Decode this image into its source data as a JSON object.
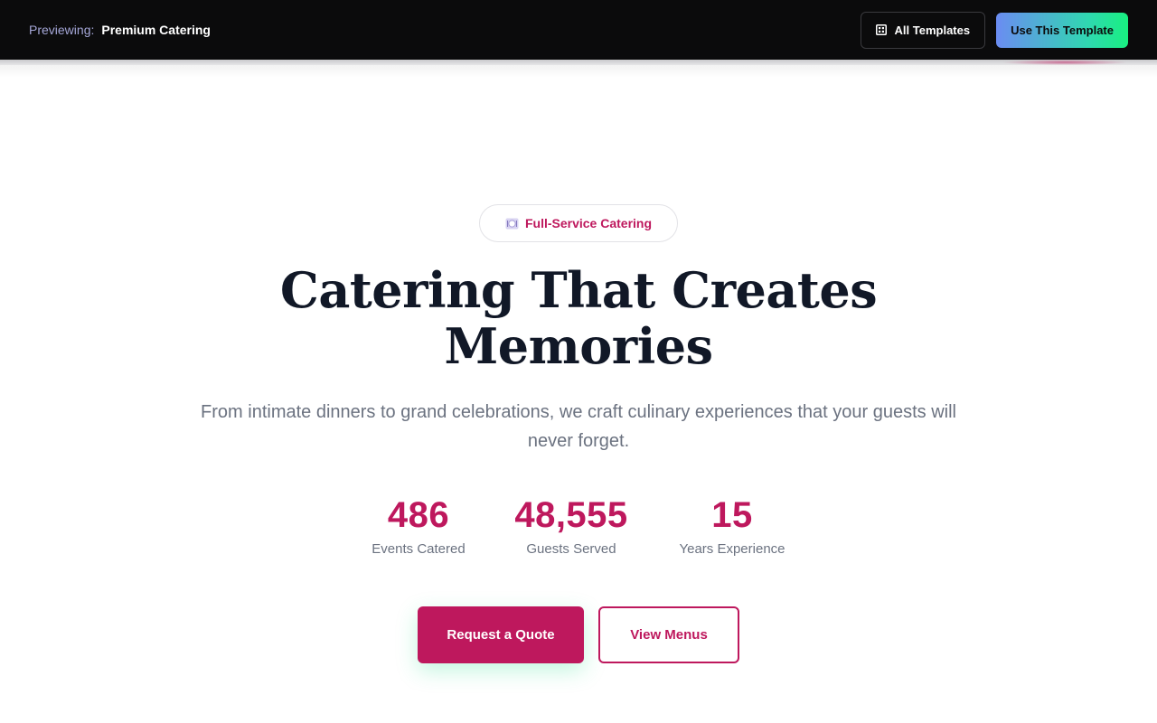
{
  "topbar": {
    "previewing_label": "Previewing:",
    "template_name": "Premium Catering",
    "all_templates_label": "All Templates",
    "all_templates_icon": "grid-icon",
    "use_template_label": "Use This Template"
  },
  "hero": {
    "badge_icon": "plate-icon",
    "badge_label": "Full-Service Catering",
    "headline_line1": "Catering That Creates",
    "headline_line2": "Memories",
    "subheadline": "From intimate dinners to grand celebrations, we craft culinary experiences that your guests will never forget.",
    "stats": [
      {
        "value": "486",
        "label": "Events Catered"
      },
      {
        "value": "48,555",
        "label": "Guests Served"
      },
      {
        "value": "15",
        "label": "Years Experience"
      }
    ],
    "primary_button": "Request a Quote",
    "secondary_button": "View Menus"
  },
  "colors": {
    "accent": "#be185d",
    "topbar_bg": "#0b0b0c",
    "heading": "#111827",
    "muted_text": "#6b7280"
  }
}
